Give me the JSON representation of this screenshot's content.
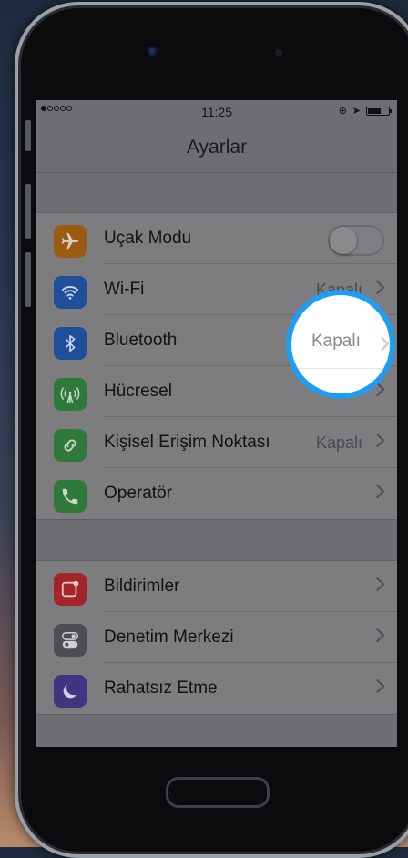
{
  "status_bar": {
    "signal_dots": 5,
    "signal_filled": 1,
    "time": "11:25"
  },
  "nav": {
    "title": "Ayarlar"
  },
  "settings_group_1": [
    {
      "label": "Uçak Modu",
      "icon": "airplane-icon",
      "color": "#9a5c12",
      "accessory": "toggle",
      "toggle_on": false
    },
    {
      "label": "Wi-Fi",
      "icon": "wifi-icon",
      "color": "#1f4f9a",
      "value": "Kapalı",
      "accessory": "chevron"
    },
    {
      "label": "Bluetooth",
      "icon": "bluetooth-icon",
      "color": "#1f4f9a",
      "value": "Kapalı",
      "accessory": "chevron"
    },
    {
      "label": "Hücresel",
      "icon": "cellular-icon",
      "color": "#2f7a3b",
      "accessory": "chevron"
    },
    {
      "label": "Kişisel Erişim Noktası",
      "icon": "hotspot-icon",
      "color": "#2f7a3b",
      "value": "Kapalı",
      "accessory": "chevron"
    },
    {
      "label": "Operatör",
      "icon": "phone-icon",
      "color": "#2f7a3b",
      "accessory": "chevron"
    }
  ],
  "settings_group_2": [
    {
      "label": "Bildirimler",
      "icon": "notifications-icon",
      "color": "#a3252a",
      "accessory": "chevron"
    },
    {
      "label": "Denetim Merkezi",
      "icon": "control-center-icon",
      "color": "#4e4e52",
      "accessory": "chevron"
    },
    {
      "label": "Rahatsız Etme",
      "icon": "moon-icon",
      "color": "#3f3580",
      "accessory": "chevron"
    }
  ],
  "highlight": {
    "target": "Bluetooth",
    "value": "Kapalı",
    "ring_color": "#1e9df2"
  }
}
